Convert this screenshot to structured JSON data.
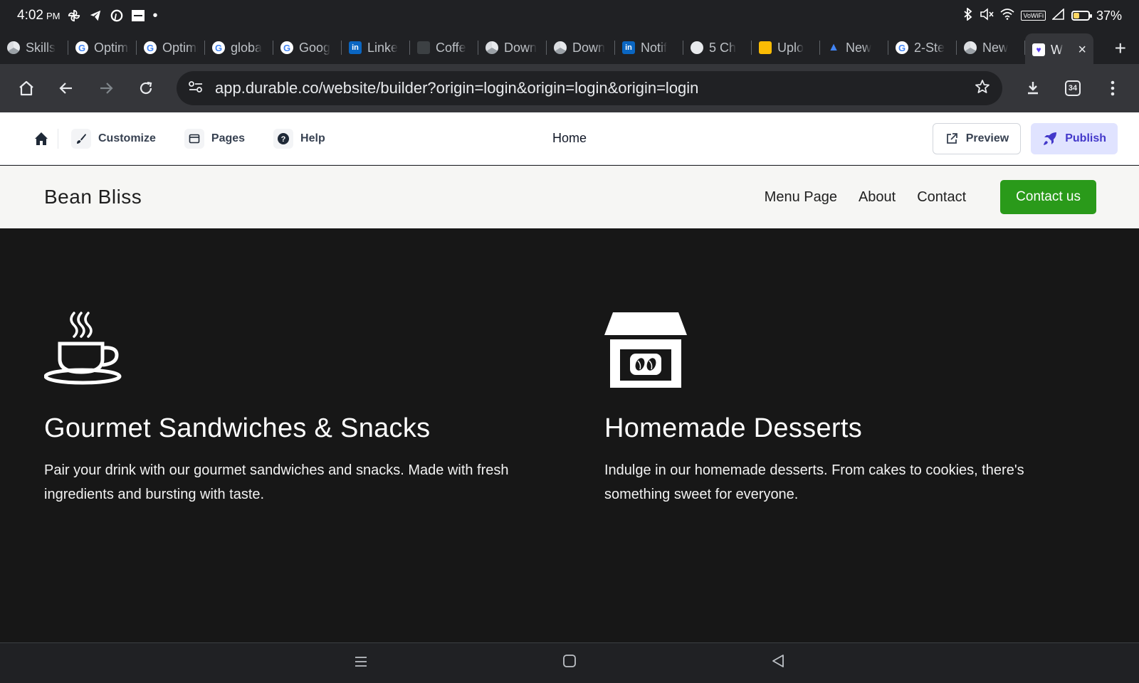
{
  "status_bar": {
    "time": "4:02",
    "ampm": "PM",
    "battery": "37%",
    "battery_level": 0.37,
    "vowifi": "VoWiFi"
  },
  "tabs": [
    {
      "label": "Skills",
      "favicon": "generic-icon"
    },
    {
      "label": "Optimi",
      "favicon": "google-icon"
    },
    {
      "label": "Optimi",
      "favicon": "google-icon"
    },
    {
      "label": "globa",
      "favicon": "google-icon"
    },
    {
      "label": "Goog",
      "favicon": "google-icon"
    },
    {
      "label": "Linke",
      "favicon": "linkedin-icon"
    },
    {
      "label": "Coffe",
      "favicon": "slack-icon"
    },
    {
      "label": "Down",
      "favicon": "chrome-icon"
    },
    {
      "label": "Down",
      "favicon": "chrome-icon"
    },
    {
      "label": "Notif",
      "favicon": "linkedin-icon"
    },
    {
      "label": "5 Ch",
      "favicon": "globe-icon"
    },
    {
      "label": "Uplo",
      "favicon": "card-icon"
    },
    {
      "label": "New",
      "favicon": "google-ads-icon"
    },
    {
      "label": "2-Ste",
      "favicon": "google-icon"
    },
    {
      "label": "New",
      "favicon": "chrome-icon"
    },
    {
      "label": "W",
      "favicon": "durable-icon",
      "active": true
    }
  ],
  "toolbar": {
    "url": "app.durable.co/website/builder?origin=login&origin=login&origin=login",
    "tab_count": "34"
  },
  "builder": {
    "customize_label": "Customize",
    "pages_label": "Pages",
    "help_label": "Help",
    "current_page": "Home",
    "preview_label": "Preview",
    "publish_label": "Publish"
  },
  "site": {
    "logo": "Bean Bliss",
    "nav": [
      "Menu Page",
      "About",
      "Contact"
    ],
    "cta": "Contact us",
    "cta_color": "#2a9a1a"
  },
  "features": [
    {
      "icon": "coffee-cup-icon",
      "title": "Gourmet Sandwiches & Snacks",
      "text": "Pair your drink with our gourmet sandwiches and snacks. Made with fresh ingredients and bursting with taste."
    },
    {
      "icon": "coffee-shop-icon",
      "title": "Homemade Desserts",
      "text": "Indulge in our homemade desserts. From cakes to cookies, there's something sweet for everyone."
    }
  ]
}
